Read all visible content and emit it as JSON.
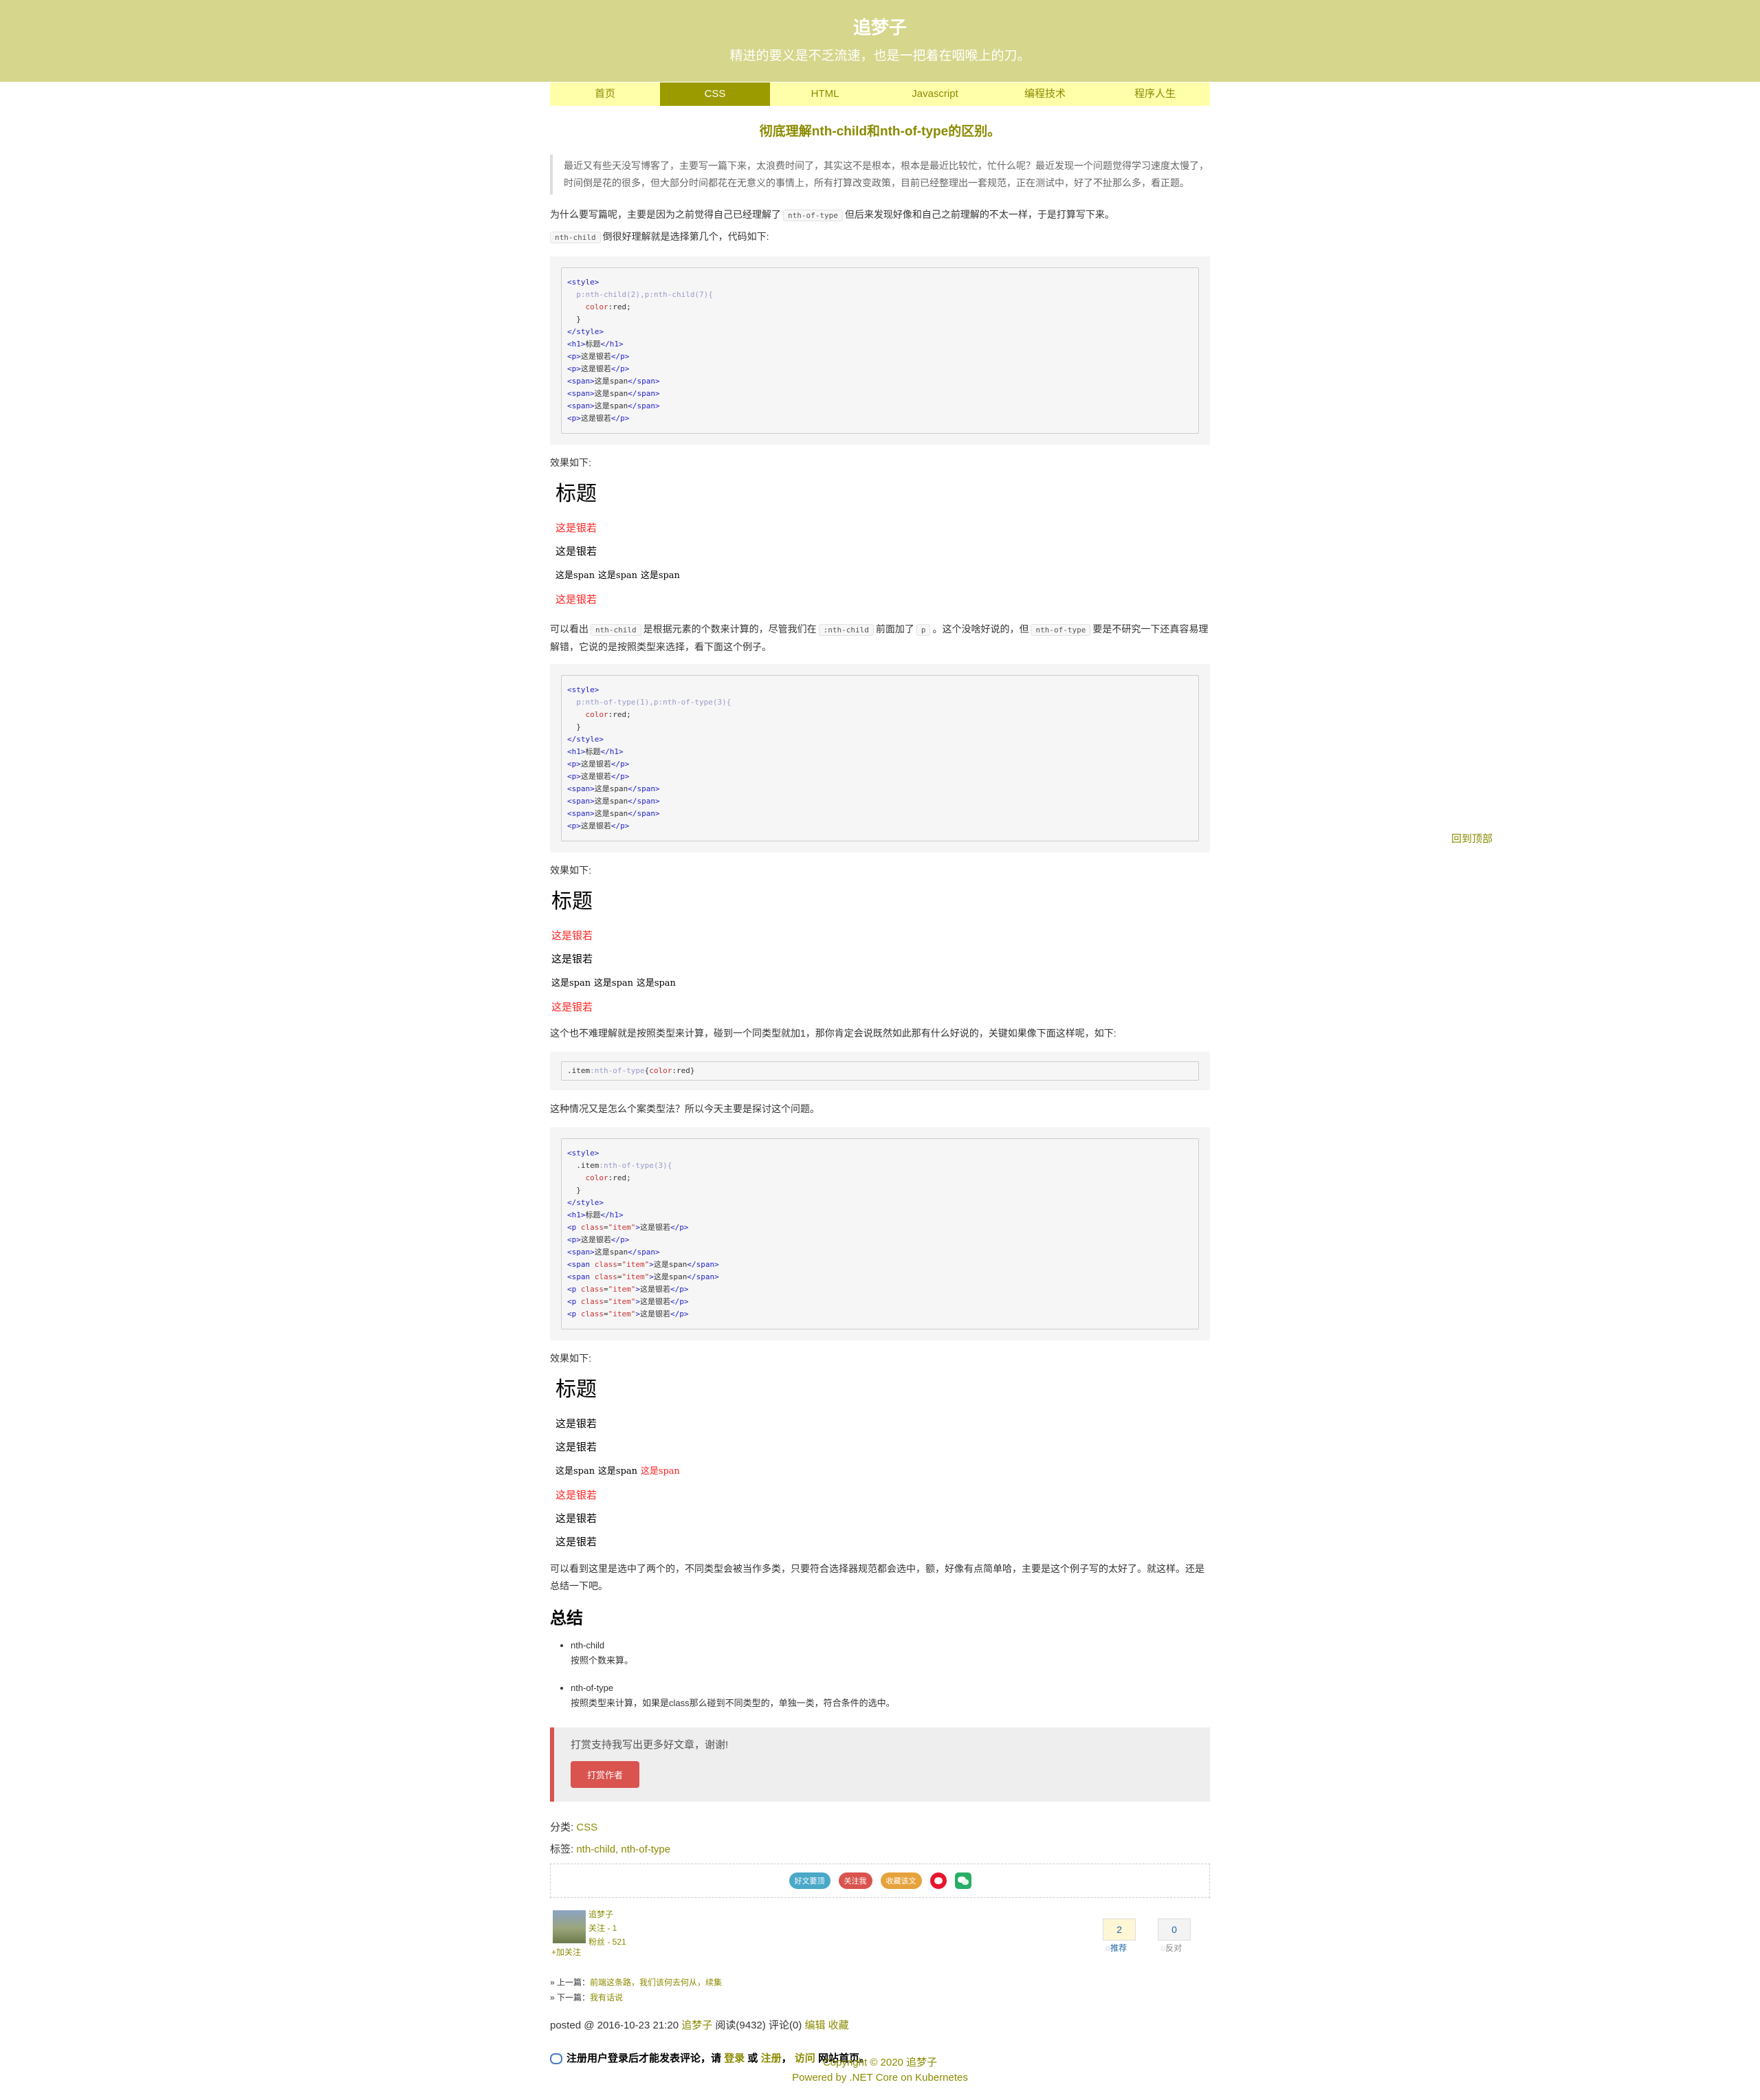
{
  "header": {
    "title": "追梦子",
    "subtitle": "精进的要义是不乏流速，也是一把着在咽喉上的刀。"
  },
  "nav": [
    "首页",
    "CSS",
    "HTML",
    "Javascript",
    "编程技术",
    "程序人生"
  ],
  "post": {
    "title": "彻底理解nth-child和nth-of-type的区别。",
    "quote": "最近又有些天没写博客了，主要写一篇下来，太浪费时间了，其实这不是根本，根本是最近比较忙，忙什么呢？最近发现一个问题觉得学习速度太慢了，时间倒是花的很多，但大部分时间都花在无意义的事情上，所有打算改变政策，目前已经整理出一套规范，正在测试中，好了不扯那么多，看正题。",
    "p1_a": "为什么要写篇呢，主要是因为之前觉得自己已经理解了",
    "p1_code": "nth-of-type",
    "p1_b": "但后来发现好像和自己之前理解的不太一样，于是打算写下来。",
    "p2_code": "nth-child",
    "p2_b": "倒很好理解就是选择第几个，代码如下:",
    "effect_label": "效果如下:",
    "p3_a": "可以看出",
    "p3_code1": "nth-child",
    "p3_b": "是根据元素的个数来计算的，尽管我们在",
    "p3_code2": ":nth-child",
    "p3_c": "前面加了",
    "p3_code3": "p",
    "p3_d": "。这个没啥好说的，但",
    "p3_code4": "nth-of-type",
    "p3_e": "要是不研究一下还真容易理解错，它说的是按照类型来选择，看下面这个例子。",
    "p4": "这个也不难理解就是按照类型来计算，碰到一个同类型就加1，那你肯定会说既然如此那有什么好说的，关键如果像下面这样呢，如下:",
    "p5": "这种情况又是怎么个案类型法？所以今天主要是探讨这个问题。",
    "p6": "可以看到这里是选中了两个的，不同类型会被当作多类，只要符合选择器规范都会选中，额，好像有点简单哈，主要是这个例子写的太好了。就这样。还是总结一下吧。",
    "summary_title": "总结",
    "summary": [
      {
        "name": "nth-child",
        "desc": "按照个数来算。"
      },
      {
        "name": "nth-of-type",
        "desc": "按照类型来计算，如果是class那么碰到不同类型的，单独一类，符合条件的选中。"
      }
    ],
    "demo": {
      "h1": "标题",
      "p1": "这是银若",
      "p2": "这是银若",
      "span": "这是span",
      "p3": "这是银若",
      "p4": "这是银若",
      "p5": "这是银若"
    }
  },
  "donate": {
    "text": "打赏支持我写出更多好文章，谢谢!",
    "button": "打赏作者"
  },
  "meta": {
    "category_label": "分类:",
    "category": "CSS",
    "tags_label": "标签:",
    "tags": "nth-child, nth-of-type"
  },
  "share": {
    "b1": "好文要顶",
    "b2": "关注我",
    "b3": "收藏该文"
  },
  "author": {
    "name": "追梦子",
    "following": "关注 - 1",
    "followers": "粉丝 - 521",
    "follow_btn": "+加关注"
  },
  "votes": {
    "up": "2",
    "up_label": "推荐",
    "down": "0",
    "down_label": "反对"
  },
  "prevnext": {
    "prev_label": "» 上一篇：",
    "prev": "前端这条路，我们该何去何从，续集",
    "next_label": "» 下一篇：",
    "next": "我有话说"
  },
  "posted": {
    "prefix": "posted @ 2016-10-23 21:20",
    "author": "追梦子",
    "reads": "阅读(9432)",
    "comments": "评论(0)",
    "edit": "编辑",
    "fav": "收藏"
  },
  "comment_notice": {
    "a": "注册用户登录后才能发表评论，请",
    "login": "登录",
    "or": "或",
    "register": "注册",
    "comma": "，",
    "visit": "访问",
    "b": "网站首页。"
  },
  "back_top": "回到顶部",
  "footer": {
    "line1": "Copyright © 2020 追梦子",
    "line2": "Powered by .NET Core on Kubernetes"
  }
}
